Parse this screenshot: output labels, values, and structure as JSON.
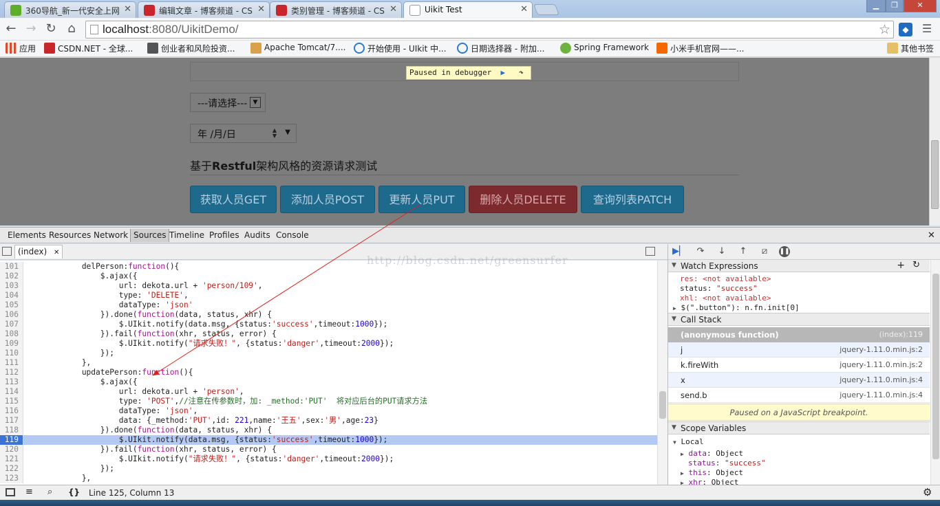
{
  "tabs": [
    {
      "label": "360导航_新一代安全上网",
      "icon_color": "#5fae2a",
      "active": false
    },
    {
      "label": "编辑文章 - 博客频道 - CS",
      "icon_color": "#c8262b",
      "active": false
    },
    {
      "label": "类别管理 - 博客频道 - CS",
      "icon_color": "#c8262b",
      "active": false
    },
    {
      "label": "Uikit Test",
      "icon_color": "#ffffff",
      "active": true
    }
  ],
  "address": {
    "url_host": "localhost",
    "url_rest": ":8080/UikitDemo/"
  },
  "bookmarks": [
    {
      "label": "应用",
      "icon": "apps-grid-icon",
      "color": "#e04a2a"
    },
    {
      "label": "CSDN.NET - 全球...",
      "icon": "csdn-icon",
      "color": "#c8262b"
    },
    {
      "label": "创业者和风险投资...",
      "icon": "page-icon",
      "color": "#555555"
    },
    {
      "label": "Apache Tomcat/7....",
      "icon": "tomcat-icon",
      "color": "#d9a24a"
    },
    {
      "label": "开始使用 - UIkit 中...",
      "icon": "uikit-icon",
      "color": "#2a7ad6"
    },
    {
      "label": "日期选择器 - 附加...",
      "icon": "uikit-icon",
      "color": "#2a7ad6"
    },
    {
      "label": "Spring Framework",
      "icon": "spring-icon",
      "color": "#6db33f"
    },
    {
      "label": "小米手机官网——...",
      "icon": "mi-icon",
      "color": "#f56700"
    },
    {
      "label": "其他书签",
      "icon": "folder-icon",
      "color": "#e6c068"
    }
  ],
  "page": {
    "paused_text": "Paused in debugger",
    "select_label": "---请选择---",
    "date_label": "年 /月/日",
    "heading_pre": "基于",
    "heading_bold": "Restful",
    "heading_post": "架构风格的资源请求测试",
    "buttons": [
      "获取人员GET",
      "添加人员POST",
      "更新人员PUT",
      "删除人员DELETE",
      "查询列表PATCH"
    ]
  },
  "devtools": {
    "tabs": [
      "Elements",
      "Resources",
      "Network",
      "Sources",
      "Timeline",
      "Profiles",
      "Audits",
      "Console"
    ],
    "active_tab": "Sources",
    "file_tab": "(index)",
    "watermark": "http://blog.csdn.net/greensurfer",
    "highlight_line": "119",
    "code_lines": [
      {
        "n": "101",
        "parts": [
          [
            "",
            "            delPerson:"
          ],
          [
            "k",
            "function"
          ],
          [
            "",
            "(){"
          ]
        ]
      },
      {
        "n": "102",
        "parts": [
          [
            "",
            "                $.ajax({"
          ]
        ]
      },
      {
        "n": "103",
        "parts": [
          [
            "",
            "                    url: dekota.url + "
          ],
          [
            "s",
            "'person/109'"
          ],
          [
            "",
            ","
          ]
        ]
      },
      {
        "n": "104",
        "parts": [
          [
            "",
            "                    type: "
          ],
          [
            "s",
            "'DELETE'"
          ],
          [
            "",
            ","
          ]
        ]
      },
      {
        "n": "105",
        "parts": [
          [
            "",
            "                    dataType: "
          ],
          [
            "s",
            "'json'"
          ]
        ]
      },
      {
        "n": "106",
        "parts": [
          [
            "",
            "                }).done("
          ],
          [
            "k",
            "function"
          ],
          [
            "",
            "(data, status, xhr) {"
          ]
        ]
      },
      {
        "n": "107",
        "parts": [
          [
            "",
            "                    $.UIkit.notify(data.msg, {status:"
          ],
          [
            "s",
            "'success'"
          ],
          [
            "",
            ",timeout:"
          ],
          [
            "n",
            "1000"
          ],
          [
            "",
            "});"
          ]
        ]
      },
      {
        "n": "108",
        "parts": [
          [
            "",
            "                }).fail("
          ],
          [
            "k",
            "function"
          ],
          [
            "",
            "(xhr, status, error) {"
          ]
        ]
      },
      {
        "n": "109",
        "parts": [
          [
            "",
            "                    $.UIkit.notify("
          ],
          [
            "s",
            "\"请求失败！\""
          ],
          [
            "",
            ", {status:"
          ],
          [
            "s",
            "'danger'"
          ],
          [
            "",
            ",timeout:"
          ],
          [
            "n",
            "2000"
          ],
          [
            "",
            "});"
          ]
        ]
      },
      {
        "n": "110",
        "parts": [
          [
            "",
            "                });"
          ]
        ]
      },
      {
        "n": "111",
        "parts": [
          [
            "",
            "            },"
          ]
        ]
      },
      {
        "n": "112",
        "parts": [
          [
            "",
            "            updatePerson:"
          ],
          [
            "k",
            "function"
          ],
          [
            "",
            "(){"
          ]
        ]
      },
      {
        "n": "113",
        "parts": [
          [
            "",
            "                $.ajax({"
          ]
        ]
      },
      {
        "n": "114",
        "parts": [
          [
            "",
            "                    url: dekota.url + "
          ],
          [
            "s",
            "'person'"
          ],
          [
            "",
            ","
          ]
        ]
      },
      {
        "n": "115",
        "parts": [
          [
            "",
            "                    type: "
          ],
          [
            "s",
            "'POST'"
          ],
          [
            "",
            ","
          ],
          [
            "c",
            "//注意在传参数时，加: _method:'PUT'  将对应后台的PUT请求方法"
          ]
        ]
      },
      {
        "n": "116",
        "parts": [
          [
            "",
            "                    dataType: "
          ],
          [
            "s",
            "'json'"
          ],
          [
            "",
            ","
          ]
        ]
      },
      {
        "n": "117",
        "parts": [
          [
            "",
            "                    data: {_method:"
          ],
          [
            "s",
            "'PUT'"
          ],
          [
            "",
            ",id: "
          ],
          [
            "n",
            "221"
          ],
          [
            "",
            ",name:"
          ],
          [
            "s",
            "'王五'"
          ],
          [
            "",
            ",sex:"
          ],
          [
            "s",
            "'男'"
          ],
          [
            "",
            ",age:"
          ],
          [
            "n",
            "23"
          ],
          [
            "",
            "}"
          ]
        ]
      },
      {
        "n": "118",
        "parts": [
          [
            "",
            "                }).done("
          ],
          [
            "k",
            "function"
          ],
          [
            "",
            "(data, status, xhr) {"
          ]
        ]
      },
      {
        "n": "119",
        "parts": [
          [
            "",
            "                    $.UIkit.notify(data.msg, {status:"
          ],
          [
            "s",
            "'success'"
          ],
          [
            "",
            ",timeout:"
          ],
          [
            "n",
            "1000"
          ],
          [
            "",
            "});"
          ]
        ]
      },
      {
        "n": "120",
        "parts": [
          [
            "",
            "                }).fail("
          ],
          [
            "k",
            "function"
          ],
          [
            "",
            "(xhr, status, error) {"
          ]
        ]
      },
      {
        "n": "121",
        "parts": [
          [
            "",
            "                    $.UIkit.notify("
          ],
          [
            "s",
            "\"请求失败！\""
          ],
          [
            "",
            ", {status:"
          ],
          [
            "s",
            "'danger'"
          ],
          [
            "",
            ",timeout:"
          ],
          [
            "n",
            "2000"
          ],
          [
            "",
            "});"
          ]
        ]
      },
      {
        "n": "122",
        "parts": [
          [
            "",
            "                });"
          ]
        ]
      },
      {
        "n": "123",
        "parts": [
          [
            "",
            "            },"
          ]
        ]
      }
    ],
    "watch_title": "Watch Expressions",
    "watch": [
      {
        "key": "res",
        "value": "<not available>",
        "kind": "na"
      },
      {
        "key": "status",
        "value": "\"success\"",
        "kind": "ok"
      },
      {
        "key": "xhl",
        "value": "<not available>",
        "kind": "na"
      },
      {
        "key": "$(\".button\")",
        "value": "n.fn.init[0]",
        "kind": "obj"
      }
    ],
    "callstack_title": "Call Stack",
    "callstack": [
      {
        "fn": "(anonymous function)",
        "loc": "(index):119"
      },
      {
        "fn": "j",
        "loc": "jquery-1.11.0.min.js:2"
      },
      {
        "fn": "k.fireWith",
        "loc": "jquery-1.11.0.min.js:2"
      },
      {
        "fn": "x",
        "loc": "jquery-1.11.0.min.js:4"
      },
      {
        "fn": "send.b",
        "loc": "jquery-1.11.0.min.js:4"
      }
    ],
    "paused_bp": "Paused on a JavaScript breakpoint.",
    "scope_title": "Scope Variables",
    "scope_local": "Local",
    "scope": [
      {
        "key": "data",
        "value": "Object",
        "expand": true
      },
      {
        "key": "status",
        "value": "\"success\"",
        "expand": false
      },
      {
        "key": "this",
        "value": "Object",
        "expand": true
      },
      {
        "key": "xhr",
        "value": "Object",
        "expand": true
      }
    ],
    "status": "Line 125, Column 13"
  }
}
